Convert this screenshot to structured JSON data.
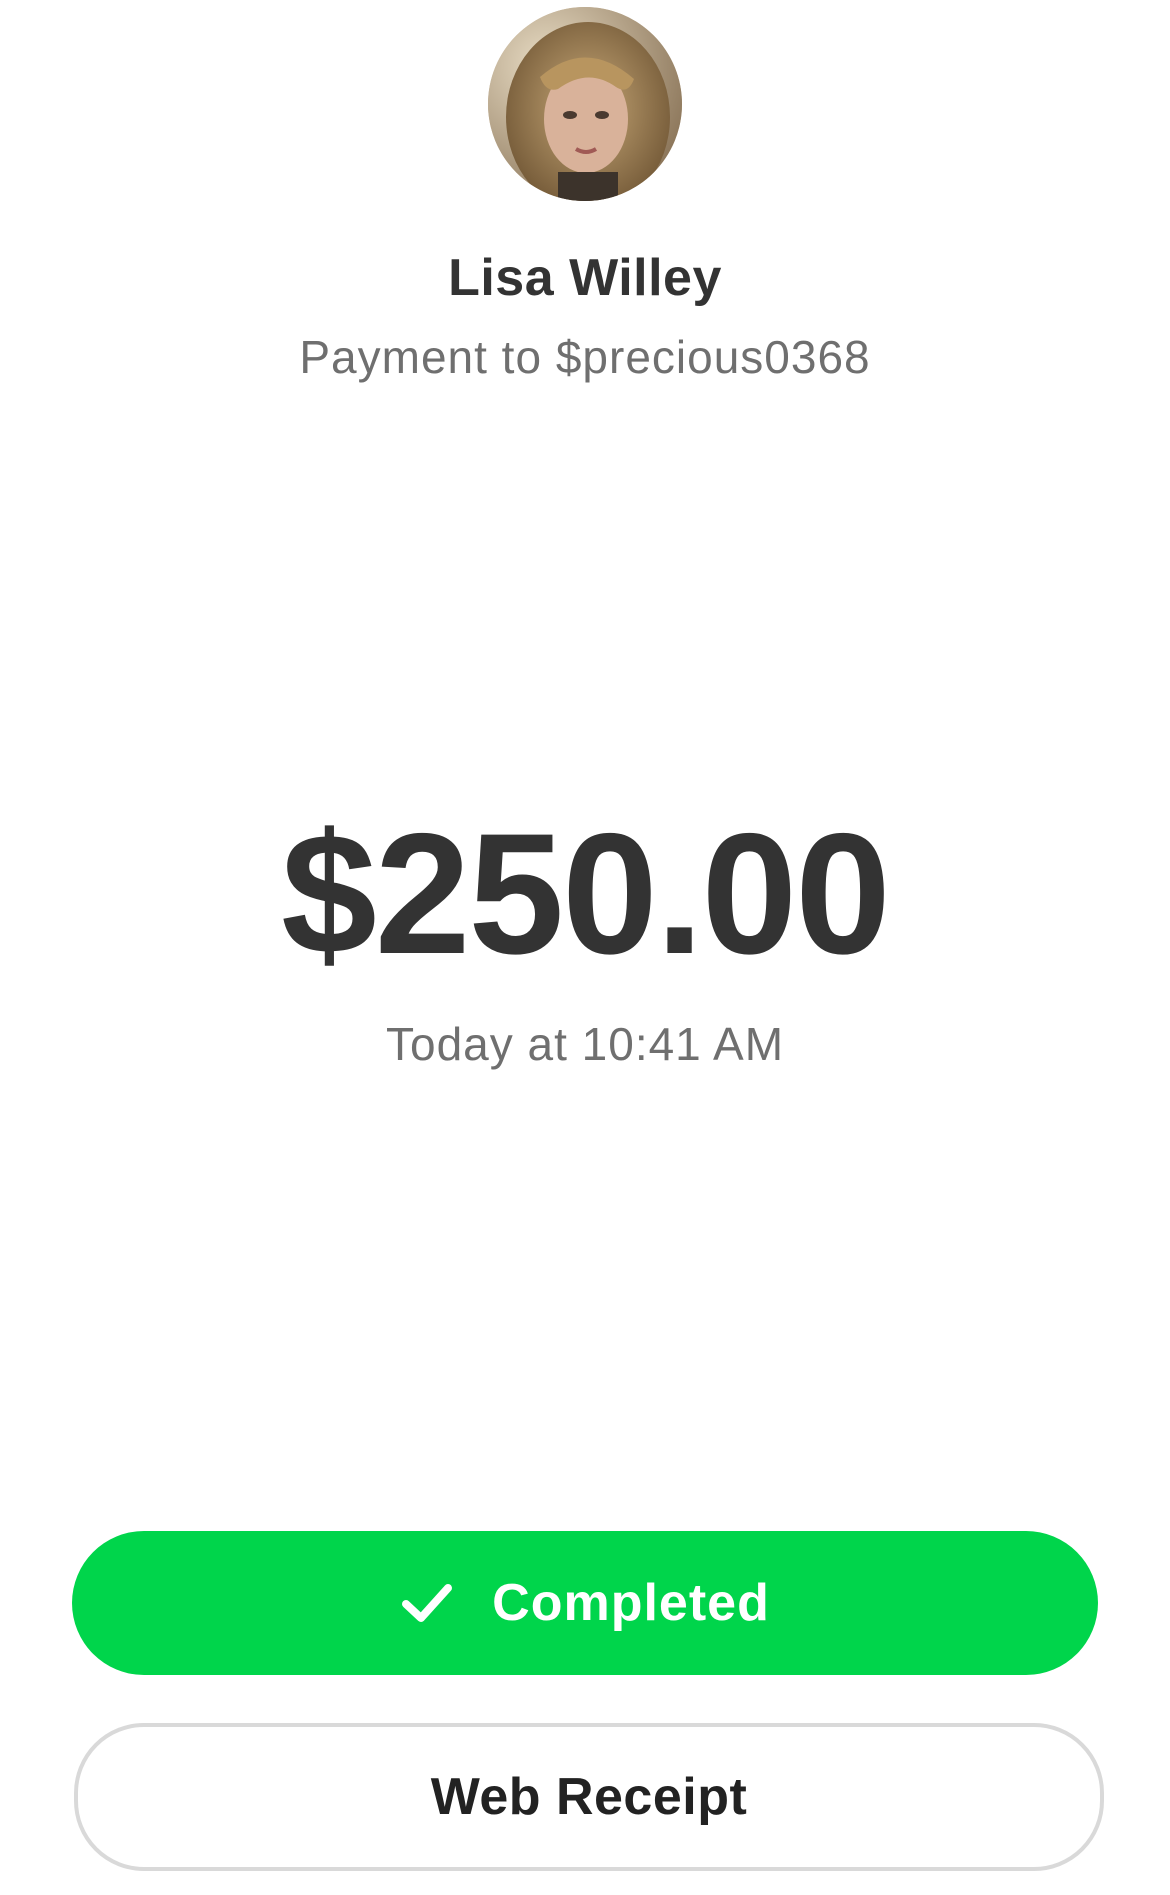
{
  "recipient": {
    "name": "Lisa Willey",
    "subtitle": "Payment to $precious0368",
    "avatar_icon": "profile-photo"
  },
  "payment": {
    "amount": "$250.00",
    "timestamp": "Today at 10:41 AM"
  },
  "status": {
    "label": "Completed",
    "icon": "checkmark-icon",
    "color": "#00d54b"
  },
  "receipt": {
    "label": "Web Receipt"
  }
}
